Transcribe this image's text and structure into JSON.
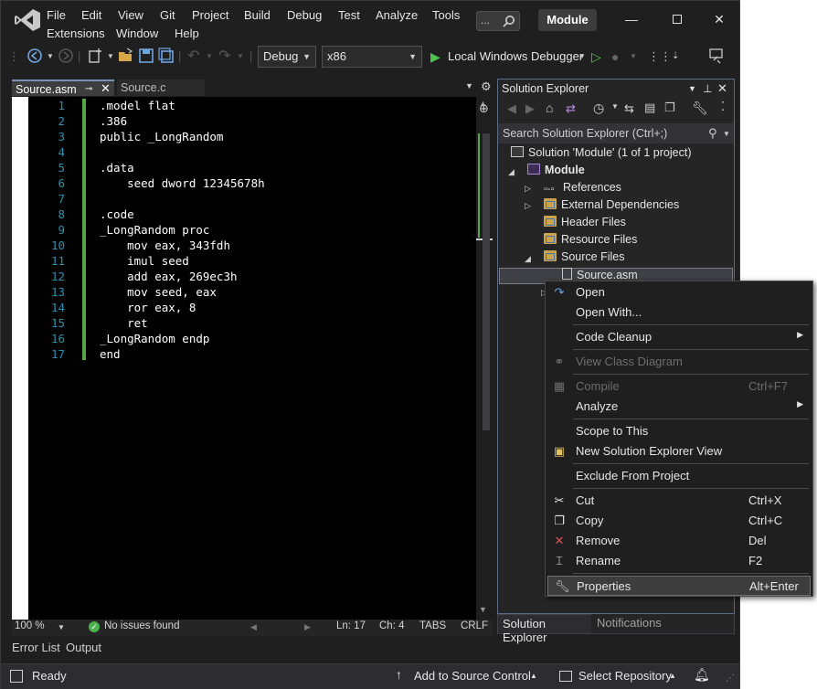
{
  "menu": {
    "items": [
      "File",
      "Edit",
      "View",
      "Git",
      "Project",
      "Build",
      "Debug",
      "Test",
      "Analyze",
      "Tools",
      "Extensions",
      "Window",
      "Help"
    ],
    "search_dots": "...",
    "project_name": "Module"
  },
  "toolbar": {
    "config": "Debug",
    "platform": "x86",
    "debugger": "Local Windows Debugger"
  },
  "editor": {
    "tabs": [
      {
        "label": "Source.asm",
        "active": true
      },
      {
        "label": "Source.c",
        "active": false
      }
    ],
    "line_numbers": [
      "1",
      "2",
      "3",
      "4",
      "5",
      "6",
      "7",
      "8",
      "9",
      "10",
      "11",
      "12",
      "13",
      "14",
      "15",
      "16",
      "17"
    ],
    "lines": [
      ".model flat",
      ".386",
      "public _LongRandom",
      "",
      ".data",
      "    seed dword 12345678h",
      "",
      ".code",
      "_LongRandom proc",
      "    mov eax, 343fdh",
      "    imul seed",
      "    add eax, 269ec3h",
      "    mov seed, eax",
      "    ror eax, 8",
      "    ret",
      "_LongRandom endp",
      "end"
    ],
    "status": {
      "zoom": "100 %",
      "issues": "No issues found",
      "line": "Ln: 17",
      "col": "Ch: 4",
      "tabs": "TABS",
      "eol": "CRLF"
    }
  },
  "bottom_tabs": [
    "Error List",
    "Output"
  ],
  "statusbar": {
    "ready": "Ready",
    "source_control": "Add to Source Control",
    "repository": "Select Repository"
  },
  "solution_explorer": {
    "title": "Solution Explorer",
    "search_placeholder": "Search Solution Explorer (Ctrl+;)",
    "solution": "Solution 'Module'  (1 of 1 project)",
    "project": "Module",
    "nodes": [
      "References",
      "External Dependencies",
      "Header Files",
      "Resource Files",
      "Source Files",
      "Source.asm"
    ],
    "footer_tabs": [
      "Solution Explorer",
      "Notifications"
    ]
  },
  "context_menu": {
    "items": [
      {
        "label": "Open",
        "shortcut": "",
        "icon": "open-redo-icon"
      },
      {
        "label": "Open With...",
        "shortcut": ""
      },
      {
        "label": "Code Cleanup",
        "shortcut": "",
        "submenu": true
      },
      {
        "label": "View Class Diagram",
        "shortcut": "",
        "disabled": true,
        "icon": "class-diagram-icon"
      },
      {
        "label": "Compile",
        "shortcut": "Ctrl+F7",
        "disabled": true,
        "icon": "compile-icon"
      },
      {
        "label": "Analyze",
        "shortcut": "",
        "submenu": true
      },
      {
        "label": "Scope to This",
        "shortcut": ""
      },
      {
        "label": "New Solution Explorer View",
        "shortcut": "",
        "icon": "new-view-icon"
      },
      {
        "label": "Exclude From Project",
        "shortcut": ""
      },
      {
        "label": "Cut",
        "shortcut": "Ctrl+X",
        "icon": "cut-icon"
      },
      {
        "label": "Copy",
        "shortcut": "Ctrl+C",
        "icon": "copy-icon"
      },
      {
        "label": "Remove",
        "shortcut": "Del",
        "icon": "remove-icon"
      },
      {
        "label": "Rename",
        "shortcut": "F2",
        "icon": "rename-icon"
      },
      {
        "label": "Properties",
        "shortcut": "Alt+Enter",
        "icon": "properties-icon",
        "highlighted": true
      }
    ]
  },
  "colors": {
    "accent": "#5a6b8c",
    "line_numbers": "#2b91af",
    "change_bar": "#57a64a",
    "remove_icon": "#e05252"
  }
}
